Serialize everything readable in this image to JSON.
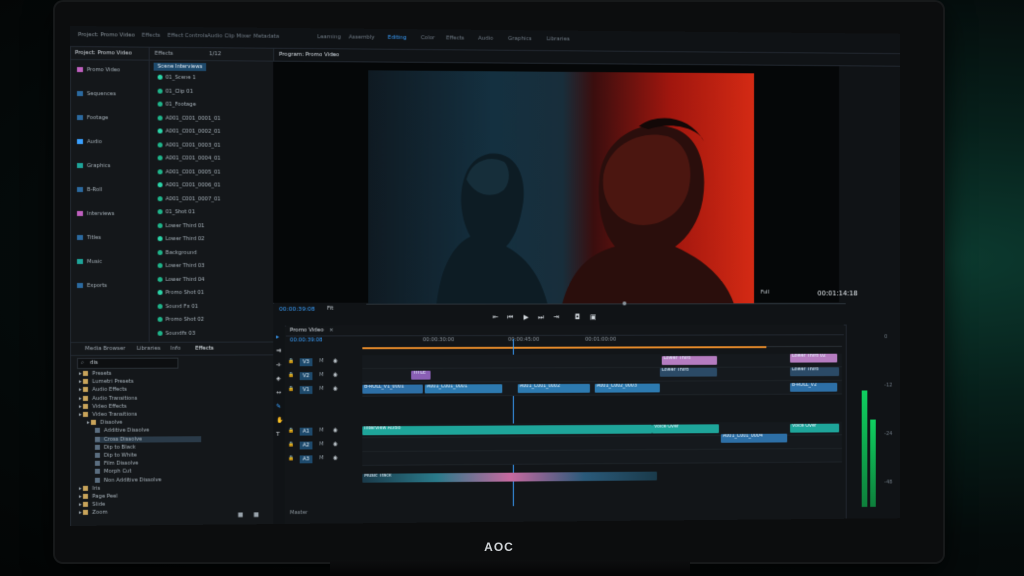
{
  "app": {
    "menu": [
      "Project: Promo Video",
      "Effects",
      "Effect Controls",
      "Audio Clip Mixer",
      "Metadata"
    ],
    "workspaces": [
      "Learning",
      "Assembly",
      "Editing",
      "Color",
      "Effects",
      "Audio",
      "Graphics",
      "Libraries"
    ],
    "active_workspace": "Editing"
  },
  "project_panel": {
    "tabs": [
      "Project: Promo Video",
      "Effects"
    ],
    "items": [
      "Promo Video",
      "Sequences",
      "Footage",
      "Audio",
      "Graphics",
      "B-Roll",
      "Interviews",
      "Titles",
      "Music",
      "Exports"
    ]
  },
  "bins_panel": {
    "tabs": [
      "Effects",
      "1/12"
    ],
    "header": "Scene Interviews",
    "items": [
      "01_Scene 1",
      "01_Clip 01",
      "01_Footage",
      "A001_C001_0001_01",
      "A001_C001_0002_01",
      "A001_C001_0003_01",
      "A001_C001_0004_01",
      "A001_C001_0005_01",
      "A001_C001_0006_01",
      "A001_C001_0007_01",
      "01_Shot 01",
      "Lower Third 01",
      "Lower Third 02",
      "Background",
      "Lower Third 03",
      "Lower Third 04",
      "Promo Shot 01",
      "Sound Fx 01",
      "Promo Shot 02",
      "Soundfx 03"
    ]
  },
  "effects_panel": {
    "tabs": [
      "Media Browser",
      "Libraries",
      "Info",
      "Effects"
    ],
    "search_placeholder": "dis",
    "tree": [
      "Presets",
      "Lumetri Presets",
      "Audio Effects",
      "Audio Transitions",
      "Video Effects",
      "Video Transitions",
      "Dissolve",
      "Additive Dissolve",
      "Cross Dissolve",
      "Dip to Black",
      "Dip to White",
      "Film Dissolve",
      "Morph Cut",
      "Non Additive Dissolve",
      "Iris",
      "Page Peel",
      "Slide",
      "Zoom"
    ],
    "selected": "Cross Dissolve"
  },
  "program_monitor": {
    "tab": "Program: Promo Video",
    "timecode_left": "00:00:39:08",
    "fit": "Fit",
    "quality": "Full",
    "timecode_right": "00:01:14:18",
    "playback_progress": 0.53
  },
  "timeline": {
    "tab": "Promo Video",
    "timecode": "00:00:39:08",
    "ruler": [
      "00:00:30:00",
      "00:00:45:00",
      "00:01:00:00"
    ],
    "playhead_fraction": 0.31,
    "video_tracks": [
      "V3",
      "V2",
      "V1"
    ],
    "audio_tracks": [
      "A1",
      "A2",
      "A3"
    ],
    "master": "Master",
    "clips": {
      "v3": [
        "Lower Third",
        "Lower Third 02"
      ],
      "v2": [
        "TITLE",
        "Lower Third",
        "Lower Third"
      ],
      "v1": [
        "B-ROLL_V1_0001",
        "A001_C001_0001",
        "A001_C001_0002",
        "A001_C002_0003",
        "B-ROLL_V2"
      ],
      "a1": [
        "Interview Audio",
        "Voice Over",
        "A001_C001_0004",
        "Voice Over"
      ],
      "a3": [
        "Music Track"
      ]
    }
  },
  "monitor": {
    "brand": "AOC"
  },
  "colors": {
    "accent": "#3aa0ff",
    "clip_video": "#2d7ab0",
    "clip_audio": "#1ea59a",
    "title_clip": "#c08cc8",
    "orange_bar": "#e58a2a"
  }
}
